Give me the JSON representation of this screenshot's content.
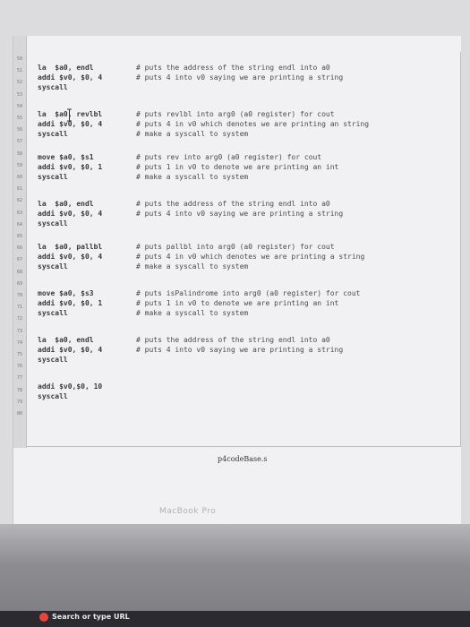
{
  "editor": {
    "line_numbers": [
      "50",
      "51",
      "52",
      "53",
      "54",
      "55",
      "56",
      "57",
      "58",
      "59",
      "60",
      "61",
      "62",
      "63",
      "64",
      "65",
      "66",
      "67",
      "68",
      "69",
      "70",
      "71",
      "72",
      "73",
      "74",
      "75",
      "76",
      "77",
      "78",
      "79",
      "80"
    ],
    "blocks": [
      {
        "code": [
          "la  $a0, endl",
          "addi $v0, $0, 4",
          "syscall"
        ],
        "comments": [
          "# puts the address of the string endl into a0",
          "# puts 4 into v0 saying we are printing a string"
        ]
      },
      {
        "code": [
          "la  $a0, revlbl",
          "addi $v0, $0, 4",
          "syscall"
        ],
        "comments": [
          "# puts revlbl into arg0 (a0 register) for cout",
          "# puts 4 in v0 which denotes we are printing an string",
          "# make a syscall to system"
        ]
      },
      {
        "code": [
          "move $a0, $s1",
          "addi $v0, $0, 1",
          "syscall"
        ],
        "comments": [
          "# puts rev into arg0 (a0 register) for cout",
          "# puts 1 in v0 to denote we are printing an int",
          "# make a syscall to system"
        ]
      },
      {
        "code": [
          "la  $a0, endl",
          "addi $v0, $0, 4",
          "syscall"
        ],
        "comments": [
          "# puts the address of the string endl into a0",
          "# puts 4 into v0 saying we are printing a string"
        ]
      },
      {
        "code": [
          "la  $a0, pallbl",
          "addi $v0, $0, 4",
          "syscall"
        ],
        "comments": [
          "# puts pallbl into arg0 (a0 register) for cout",
          "# puts 4 in v0 which denotes we are printing a string",
          "# make a syscall to system"
        ]
      },
      {
        "code": [
          "move $a0, $s3",
          "addi $v0, $0, 1",
          "syscall"
        ],
        "comments": [
          "# puts isPalindrome into arg0 (a0 register) for cout",
          "# puts 1 in v0 to denote we are printing an int",
          "# make a syscall to system"
        ]
      },
      {
        "code": [
          "la  $a0, endl",
          "addi $v0, $0, 4",
          "syscall"
        ],
        "comments": [
          "# puts the address of the string endl into a0",
          "# puts 4 into v0 saying we are printing a string"
        ]
      },
      {
        "code": [
          "addi $v0,$0, 10",
          "syscall"
        ],
        "comments": []
      }
    ],
    "filename": "p4codeBase.s"
  },
  "bezel": {
    "brand": "MacBook Pro"
  },
  "taskbar": {
    "search_label": "Search or type URL"
  },
  "colors": {
    "page": "#f1f1f3",
    "bezel": "#8d8c90"
  }
}
